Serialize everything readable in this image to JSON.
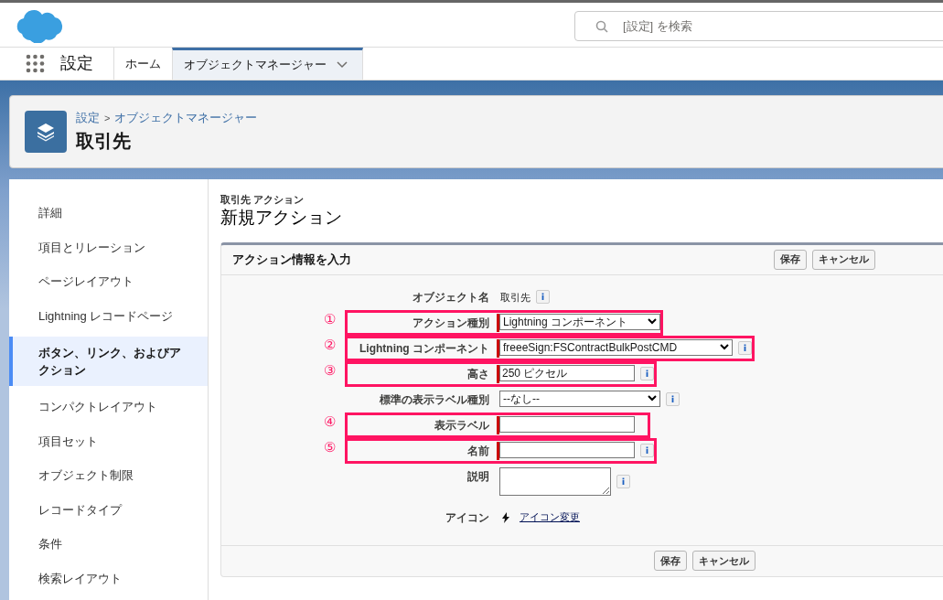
{
  "top_bar": {
    "search": {
      "placeholder": "[設定] を検索"
    }
  },
  "nav": {
    "app_name": "設定",
    "tabs": [
      {
        "label": "ホーム",
        "selected": false,
        "menu": false
      },
      {
        "label": "オブジェクトマネージャー",
        "selected": true,
        "menu": true
      }
    ]
  },
  "header": {
    "breadcrumb": [
      {
        "label": "設定"
      },
      {
        "label": "オブジェクトマネージャー"
      }
    ],
    "separator": ">",
    "title": "取引先"
  },
  "sidebar": {
    "items": [
      {
        "label": "詳細",
        "selected": false
      },
      {
        "label": "項目とリレーション",
        "selected": false
      },
      {
        "label": "ページレイアウト",
        "selected": false
      },
      {
        "label": "Lightning レコードページ",
        "selected": false
      },
      {
        "label": "ボタン、リンク、およびアクション",
        "selected": true
      },
      {
        "label": "コンパクトレイアウト",
        "selected": false
      },
      {
        "label": "項目セット",
        "selected": false
      },
      {
        "label": "オブジェクト制限",
        "selected": false
      },
      {
        "label": "レコードタイプ",
        "selected": false
      },
      {
        "label": "条件",
        "selected": false
      },
      {
        "label": "検索レイアウト",
        "selected": false
      }
    ]
  },
  "page": {
    "subtitle": "取引先 アクション",
    "title": "新規アクション"
  },
  "form": {
    "title": "アクション情報を入力",
    "buttons": [
      "保存",
      "キャンセル"
    ],
    "footer_buttons": [
      "保存",
      "キャンセル"
    ],
    "fields": [
      {
        "label": "オブジェクト名",
        "kind": "text",
        "value": "取引先",
        "required": false,
        "info": true
      },
      {
        "label": "アクション種別",
        "kind": "select",
        "value": "Lightning コンポーネント",
        "required": true,
        "info": false,
        "marker": "①"
      },
      {
        "label": "Lightning コンポーネント",
        "kind": "select",
        "value": "freeeSign:FSContractBulkPostCMD",
        "required": true,
        "info": true,
        "marker": "②"
      },
      {
        "label": "高さ",
        "kind": "input",
        "value": "250 ピクセル",
        "required": true,
        "info": true,
        "marker": "③"
      },
      {
        "label": "標準の表示ラベル種別",
        "kind": "select",
        "value": "--なし--",
        "required": false,
        "info": true
      },
      {
        "label": "表示ラベル",
        "kind": "input",
        "required": true,
        "info": false,
        "marker": "④"
      },
      {
        "label": "名前",
        "kind": "input",
        "required": true,
        "info": true,
        "marker": "⑤"
      },
      {
        "label": "説明",
        "kind": "textarea",
        "required": false,
        "info": true
      },
      {
        "label": "アイコン",
        "kind": "link",
        "value": "アイコン変更",
        "required": false,
        "info": false
      }
    ]
  }
}
